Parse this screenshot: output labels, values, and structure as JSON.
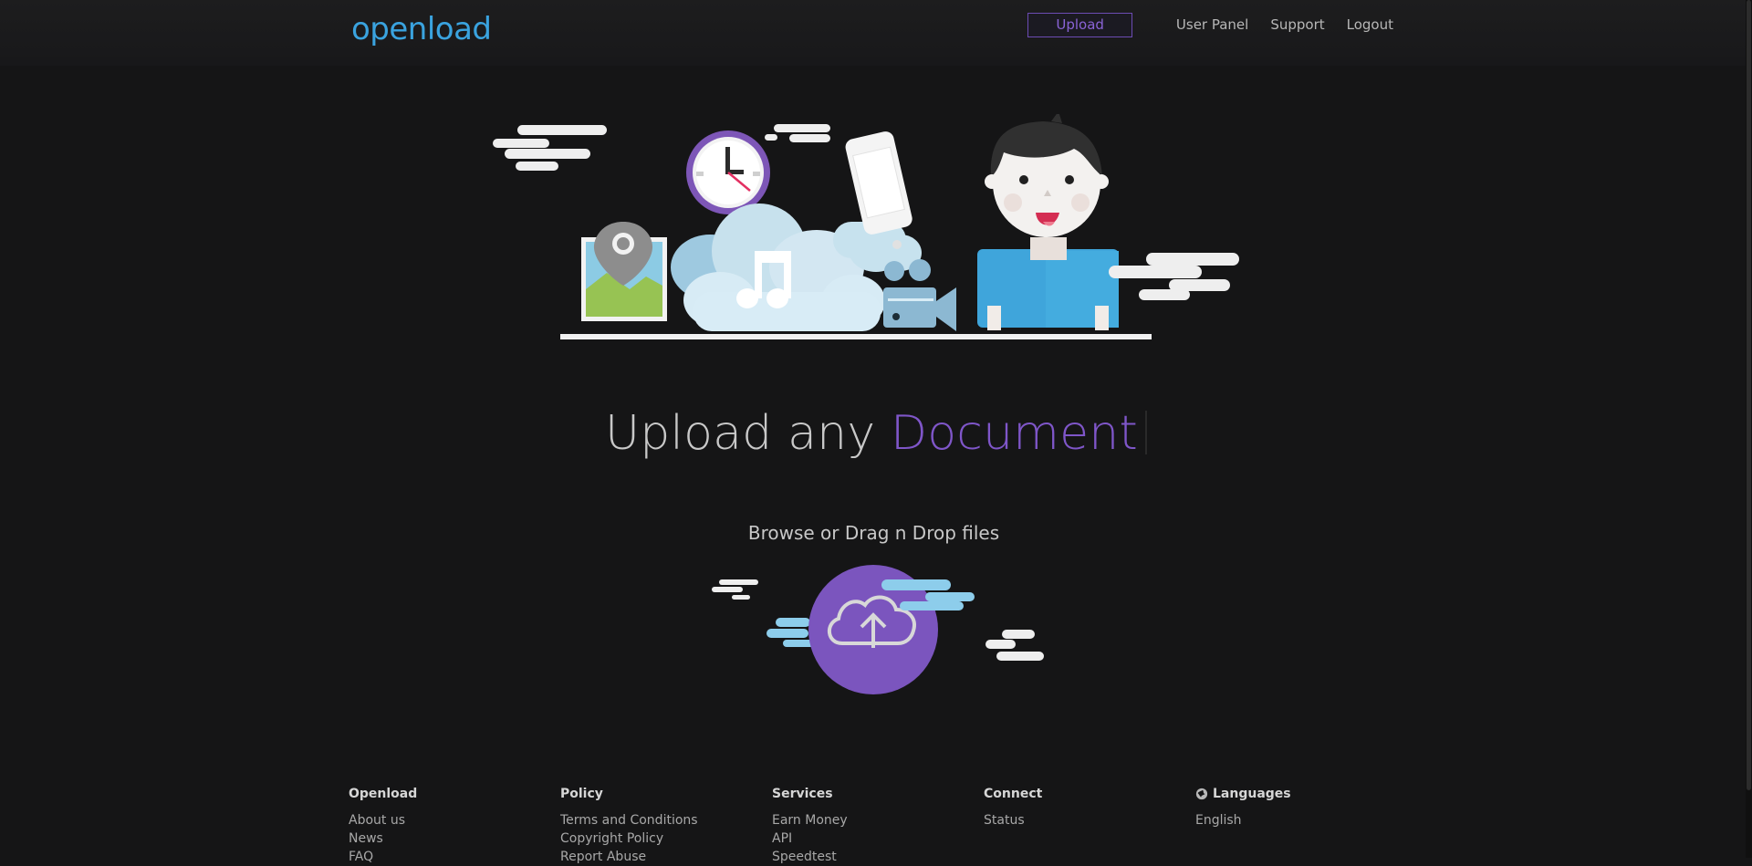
{
  "header": {
    "logo": "openload",
    "nav": {
      "upload": "Upload",
      "user_panel": "User Panel",
      "support": "Support",
      "logout": "Logout"
    }
  },
  "hero": {
    "headline_prefix": "Upload any",
    "headline_accent": "Document",
    "subhead": "Browse or Drag n Drop files"
  },
  "footer": {
    "columns": [
      {
        "title": "Openload",
        "links": [
          "About us",
          "News",
          "FAQ"
        ]
      },
      {
        "title": "Policy",
        "links": [
          "Terms and Conditions",
          "Copyright Policy",
          "Report Abuse"
        ]
      },
      {
        "title": "Services",
        "links": [
          "Earn Money",
          "API",
          "Speedtest"
        ]
      },
      {
        "title": "Connect",
        "links": [
          "Status"
        ]
      },
      {
        "title": "Languages",
        "links": [
          "English"
        ]
      }
    ]
  },
  "colors": {
    "background": "#151516",
    "accent_purple": "#7f56c9",
    "logo_blue": "#3aa3df"
  },
  "icons": {
    "upload_cloud": "cloud-upload-icon",
    "globe": "globe-icon"
  }
}
